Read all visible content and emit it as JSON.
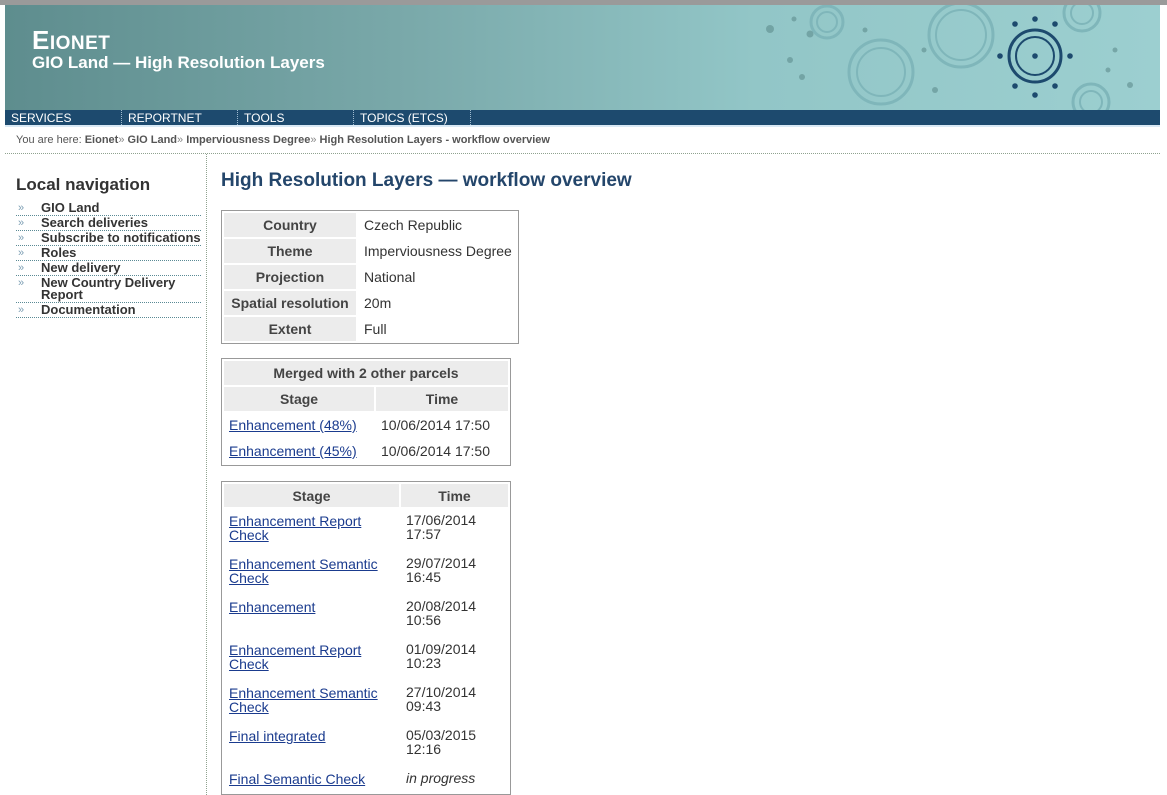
{
  "header": {
    "logo_first": "E",
    "logo_rest": "IONET",
    "subtitle": "GIO Land — High Resolution Layers"
  },
  "topnav": [
    "SERVICES",
    "REPORTNET",
    "TOOLS",
    "TOPICS (ETCS)"
  ],
  "breadcrumb": {
    "prefix": "You are here:",
    "items": [
      "Eionet",
      "GIO Land",
      "Imperviousness Degree"
    ],
    "current": "High Resolution Layers - workflow overview",
    "sep": "»"
  },
  "local_nav": {
    "title": "Local navigation",
    "items": [
      "GIO Land",
      "Search deliveries",
      "Subscribe to notifications",
      "Roles",
      "New delivery",
      "New Country Delivery Report",
      "Documentation"
    ]
  },
  "page_title": "High Resolution Layers — workflow overview",
  "info_table": [
    {
      "label": "Country",
      "value": "Czech Republic"
    },
    {
      "label": "Theme",
      "value": "Imperviousness Degree"
    },
    {
      "label": "Projection",
      "value": "National"
    },
    {
      "label": "Spatial resolution",
      "value": "20m"
    },
    {
      "label": "Extent",
      "value": "Full"
    }
  ],
  "merged_table": {
    "caption": "Merged with 2 other parcels",
    "headers": [
      "Stage",
      "Time"
    ],
    "rows": [
      {
        "stage": "Enhancement (48%)",
        "time": "10/06/2014 17:50"
      },
      {
        "stage": "Enhancement (45%)",
        "time": "10/06/2014 17:50"
      }
    ]
  },
  "stage_table": {
    "headers": [
      "Stage",
      "Time"
    ],
    "rows": [
      {
        "stage": "Enhancement Report Check",
        "date": "17/06/2014",
        "clock": "17:57"
      },
      {
        "stage": "Enhancement Semantic Check",
        "date": "29/07/2014",
        "clock": "16:45"
      },
      {
        "stage": "Enhancement",
        "date": "20/08/2014",
        "clock": "10:56"
      },
      {
        "stage": "Enhancement Report Check",
        "date": "01/09/2014",
        "clock": "10:23"
      },
      {
        "stage": "Enhancement Semantic Check",
        "date": "27/10/2014",
        "clock": "09:43"
      },
      {
        "stage": "Final integrated",
        "date": "05/03/2015",
        "clock": "12:16"
      },
      {
        "stage": "Final Semantic Check",
        "status": "in progress"
      }
    ]
  },
  "colors": {
    "nav_bg": "#1d4a6e",
    "title": "#24466b",
    "header_teal": "#92c6c7",
    "link": "#1a3b8e"
  }
}
